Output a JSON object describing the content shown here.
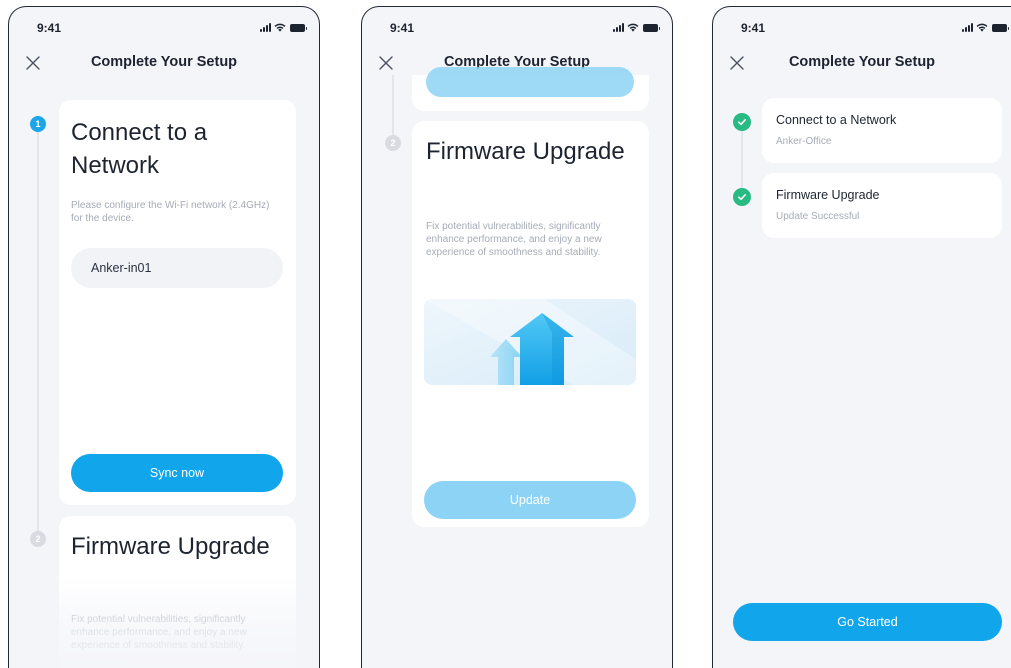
{
  "status_bar": {
    "time": "9:41"
  },
  "header": {
    "title": "Complete Your Setup"
  },
  "screen1": {
    "step1": {
      "number": "1",
      "title": "Connect to a Network",
      "description": "Please configure the Wi-Fi network (2.4GHz) for the device.",
      "network_value": "Anker-in01",
      "button_label": "Sync now"
    },
    "step2": {
      "number": "2",
      "title": "Firmware Upgrade",
      "description": "Fix potential vulnerabilities, significantly enhance performance, and enjoy a new experience of smoothness and stability."
    }
  },
  "screen2": {
    "step2": {
      "number": "2",
      "title": "Firmware Upgrade",
      "description": "Fix potential vulnerabilities, significantly enhance performance, and enjoy a new experience of smoothness and stability.",
      "button_label": "Update"
    }
  },
  "screen3": {
    "items": [
      {
        "title": "Connect to a Network",
        "subtitle": "Anker-Office"
      },
      {
        "title": "Firmware Upgrade",
        "subtitle": "Update Successful"
      }
    ],
    "button_label": "Go Started"
  },
  "icons": [
    "close-icon",
    "signal-icon",
    "wifi-icon",
    "battery-icon",
    "check-icon",
    "upgrade-arrows-icon"
  ],
  "colors": {
    "accent": "#11a6eb",
    "accent_disabled": "#8dd3f5",
    "success": "#27ba82",
    "background": "#f4f5f9",
    "card": "#ffffff"
  }
}
